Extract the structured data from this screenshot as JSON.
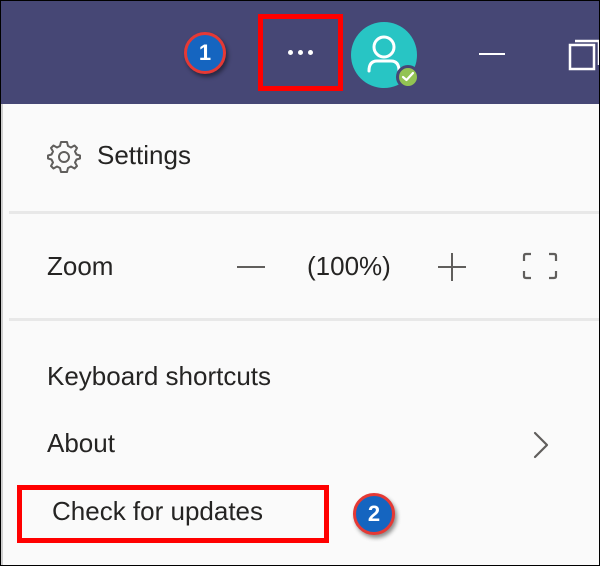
{
  "titlebar": {
    "background_color": "#464775",
    "more_button_icon": "ellipsis-icon",
    "avatar_icon": "person-icon",
    "status_icon": "checkmark-icon",
    "status_color": "#92c353",
    "minimize_icon": "minimize-icon",
    "maximize_icon": "maximize-icon"
  },
  "annotations": {
    "step_1": "1",
    "step_2": "2",
    "highlight_color": "#ff0000",
    "badge_color": "#1565c0"
  },
  "menu": {
    "settings": {
      "label": "Settings",
      "icon": "gear-icon"
    },
    "zoom": {
      "label": "Zoom",
      "value": "(100%)",
      "decrease_icon": "minus-icon",
      "increase_icon": "plus-icon",
      "fullscreen_icon": "fullscreen-icon"
    },
    "keyboard_shortcuts": {
      "label": "Keyboard shortcuts"
    },
    "about": {
      "label": "About",
      "icon": "chevron-right-icon"
    },
    "check_for_updates": {
      "label": "Check for updates"
    }
  }
}
